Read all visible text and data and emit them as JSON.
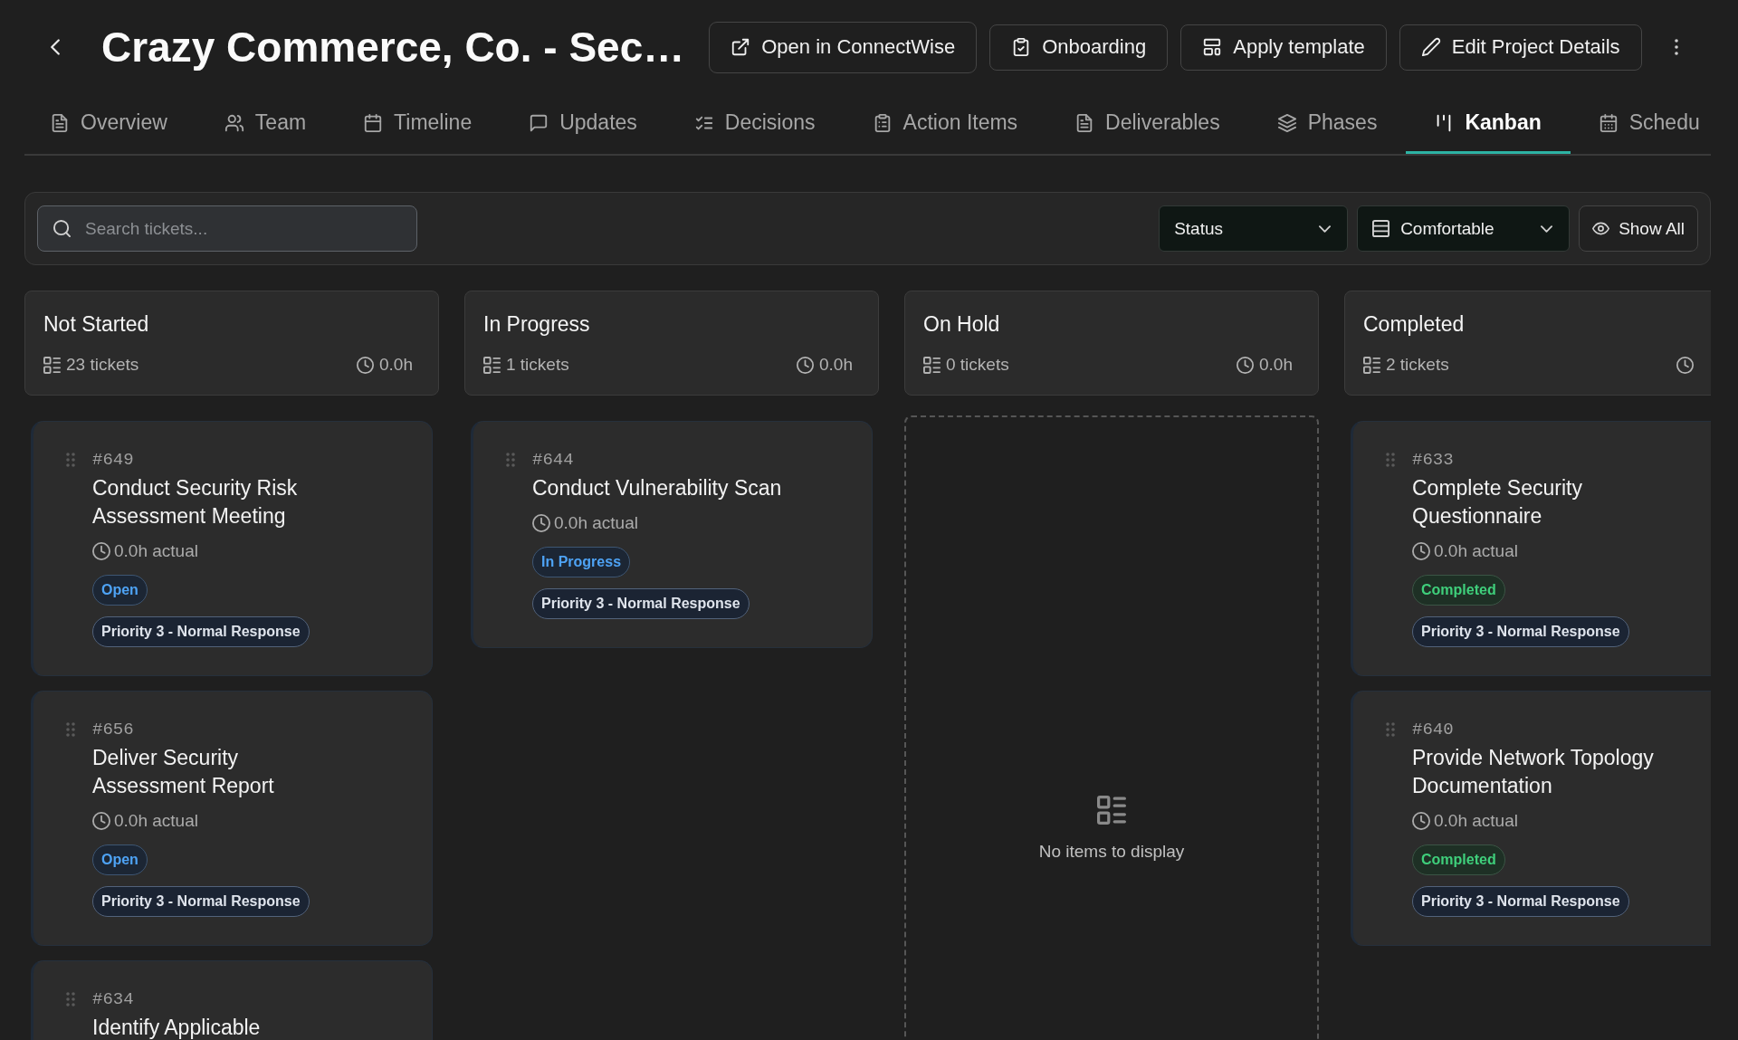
{
  "header": {
    "title": "Crazy Commerce, Co. - Sec…",
    "actions": [
      {
        "label": "Open in ConnectWise"
      },
      {
        "label": "Onboarding"
      },
      {
        "label": "Apply template"
      },
      {
        "label": "Edit Project Details"
      }
    ]
  },
  "tabs": [
    {
      "label": "Overview",
      "selected": false
    },
    {
      "label": "Team",
      "selected": false
    },
    {
      "label": "Timeline",
      "selected": false
    },
    {
      "label": "Updates",
      "selected": false
    },
    {
      "label": "Decisions",
      "selected": false
    },
    {
      "label": "Action Items",
      "selected": false
    },
    {
      "label": "Deliverables",
      "selected": false
    },
    {
      "label": "Phases",
      "selected": false
    },
    {
      "label": "Kanban",
      "selected": true
    },
    {
      "label": "Schedu",
      "selected": false
    }
  ],
  "toolbar": {
    "search": {
      "placeholder": "Search tickets..."
    },
    "filters": [
      {
        "label": "Status"
      },
      {
        "label": "Comfortable"
      }
    ],
    "show_all": {
      "label": "Show All"
    }
  },
  "columns": [
    {
      "title": "Not Started",
      "count": "23 tickets",
      "hours": "0.0h",
      "tickets": [
        {
          "number": "#649",
          "title": "Conduct Security Risk Assessment Meeting",
          "actual": "0.0h actual",
          "status": {
            "label": "Open",
            "kind": "open"
          },
          "priority": "Priority 3 - Normal Response"
        },
        {
          "number": "#656",
          "title": "Deliver Security Assessment Report",
          "actual": "0.0h actual",
          "status": {
            "label": "Open",
            "kind": "open"
          },
          "priority": "Priority 3 - Normal Response"
        },
        {
          "number": "#634",
          "title": "Identify Applicable"
        }
      ]
    },
    {
      "title": "In Progress",
      "count": "1 tickets",
      "hours": "0.0h",
      "tickets": [
        {
          "number": "#644",
          "title": "Conduct Vulnerability Scan",
          "actual": "0.0h actual",
          "status": {
            "label": "In Progress",
            "kind": "in_progress"
          },
          "priority": "Priority 3 - Normal Response"
        }
      ]
    },
    {
      "title": "On Hold",
      "count": "0 tickets",
      "hours": "0.0h",
      "empty_text": "No items to display"
    },
    {
      "title": "Completed",
      "count": "2 tickets",
      "tickets": [
        {
          "number": "#633",
          "title": "Complete Security Questionnaire",
          "actual": "0.0h actual",
          "status": {
            "label": "Completed",
            "kind": "completed"
          },
          "priority": "Priority 3 - Normal Response"
        },
        {
          "number": "#640",
          "title": "Provide Network Topology Documentation",
          "actual": "0.0h actual",
          "status": {
            "label": "Completed",
            "kind": "completed"
          },
          "priority": "Priority 3 - Normal Response"
        }
      ]
    }
  ]
}
